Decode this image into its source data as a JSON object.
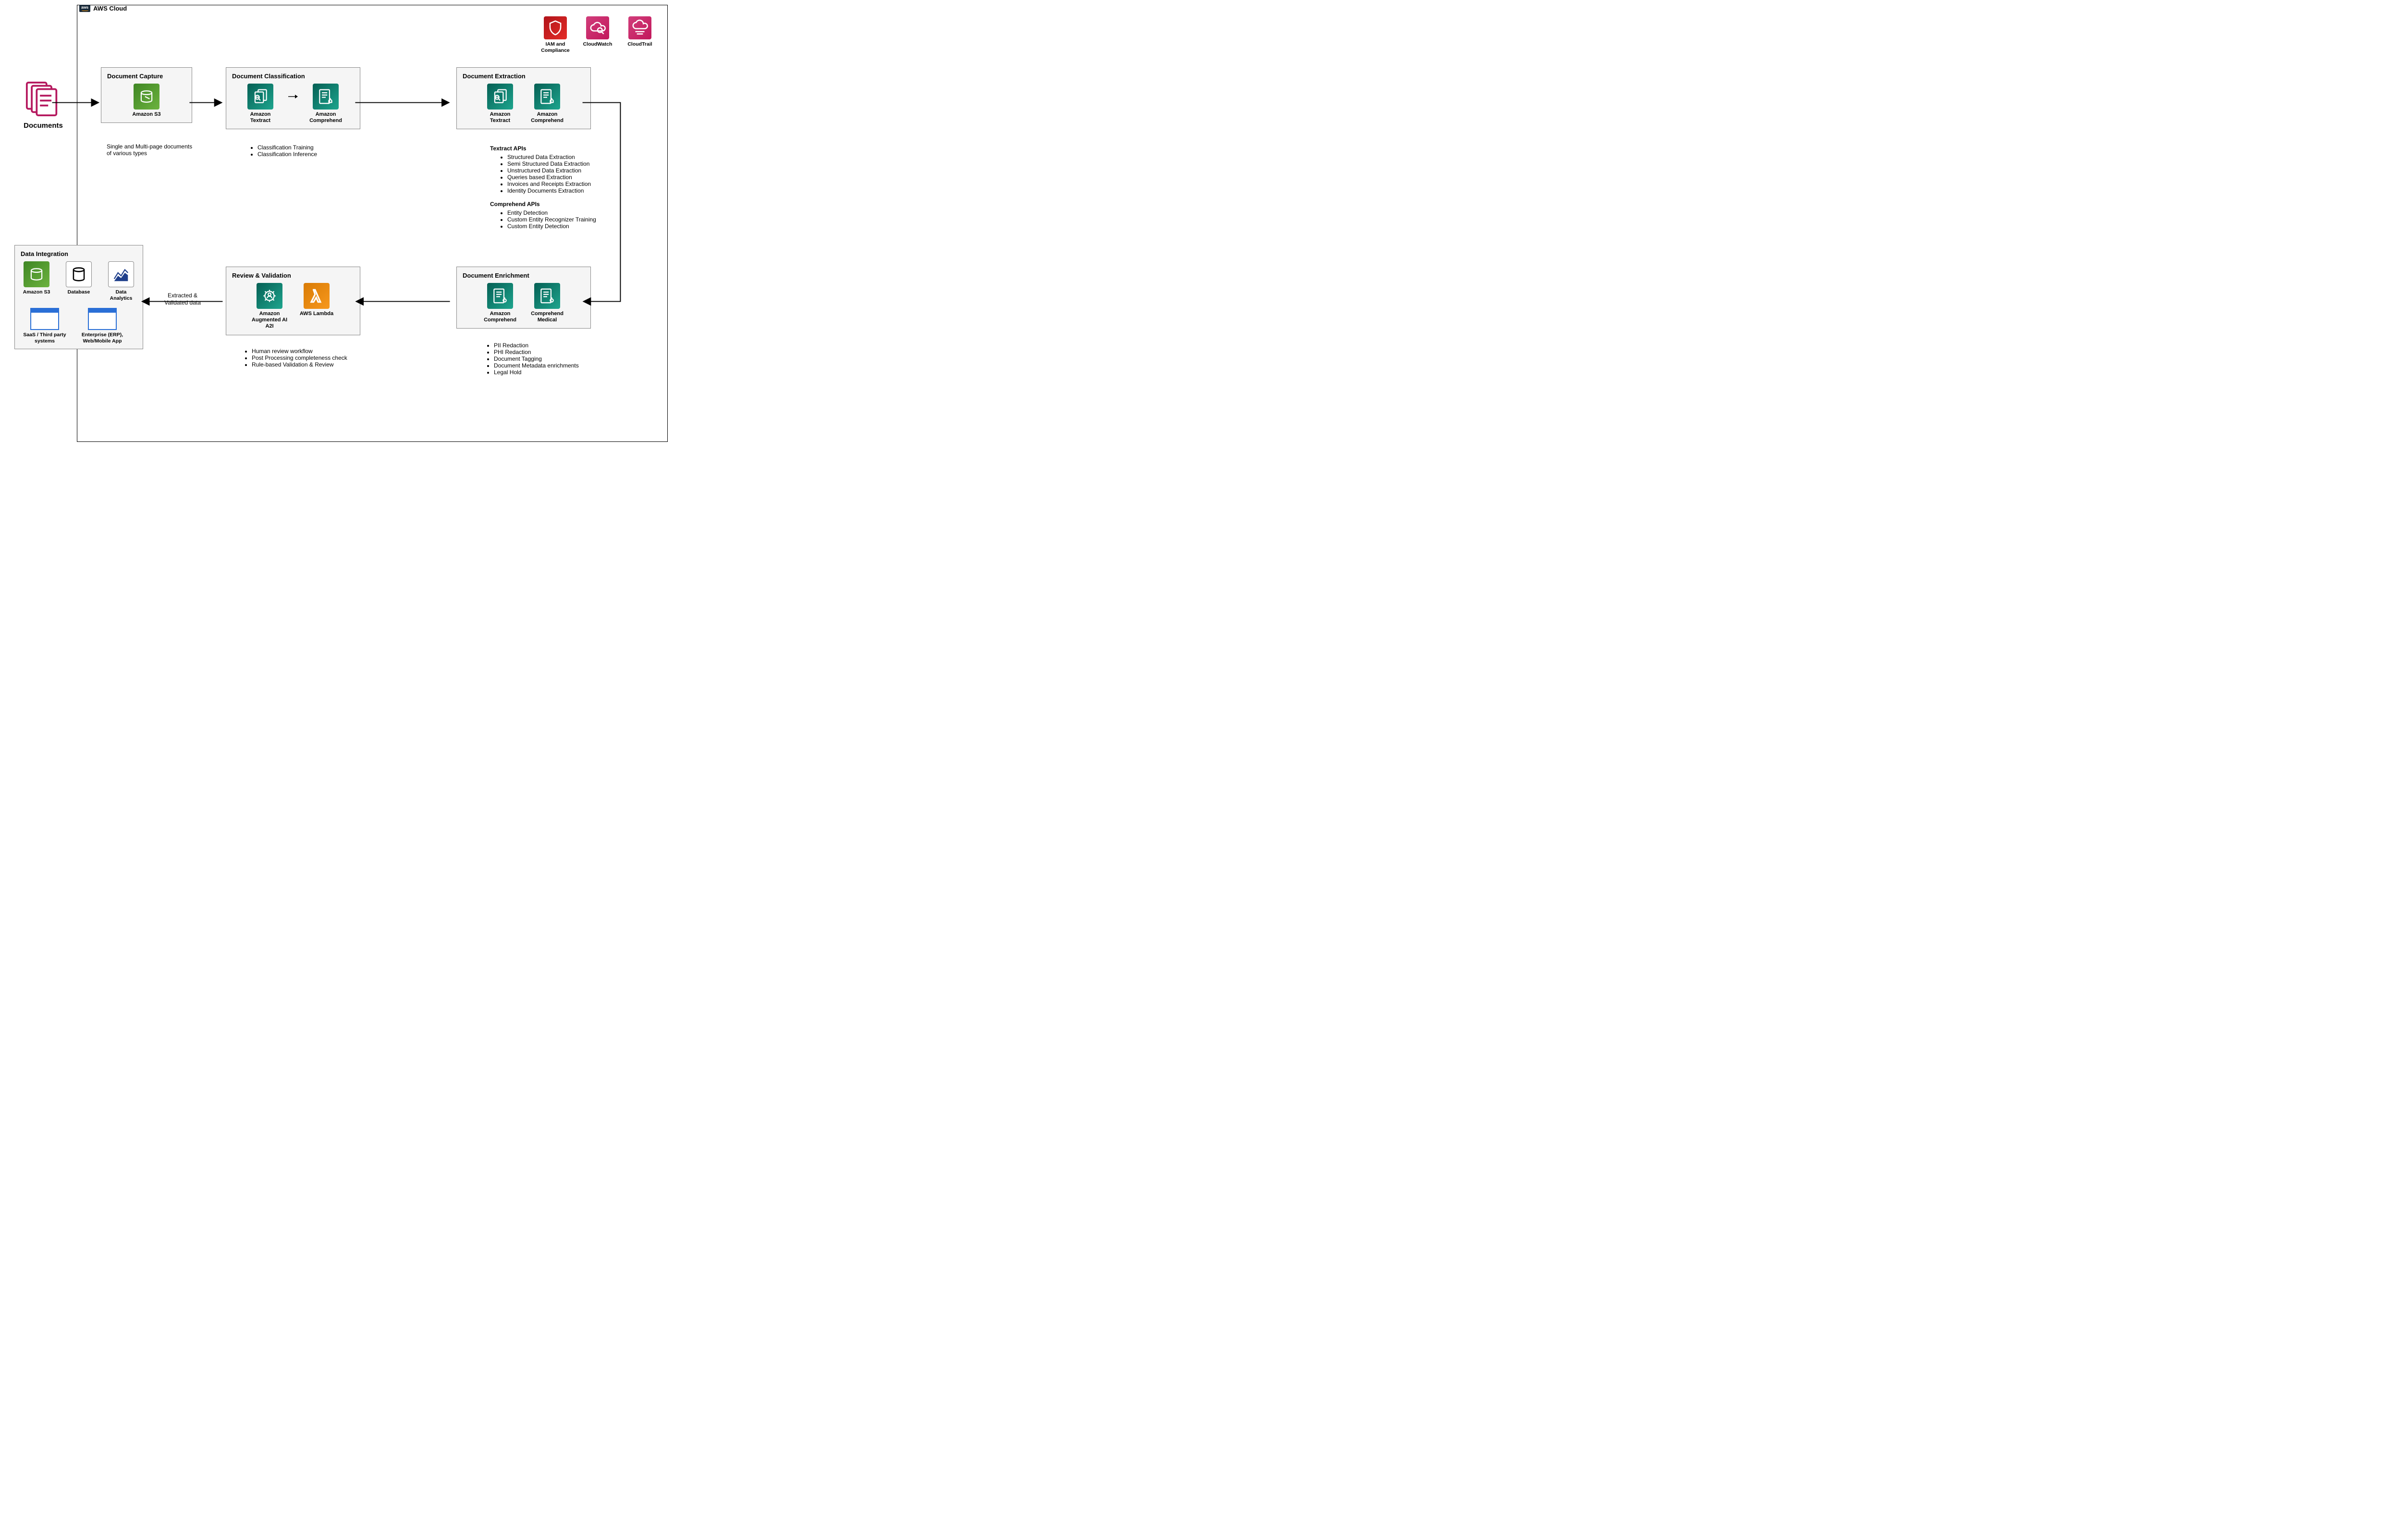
{
  "cloud_label": "AWS Cloud",
  "top_services": [
    {
      "name": "iam-compliance",
      "label": "IAM and Compliance"
    },
    {
      "name": "cloudwatch",
      "label": "CloudWatch"
    },
    {
      "name": "cloudtrail",
      "label": "CloudTrail"
    }
  ],
  "documents": {
    "label": "Documents"
  },
  "capture": {
    "title": "Document Capture",
    "service": "Amazon S3",
    "note": "Single and Multi-page documents of various types"
  },
  "classify": {
    "title": "Document Classification",
    "services": [
      "Amazon Textract",
      "Amazon Comprehend"
    ],
    "bullets": [
      "Classification Training",
      "Classification Inference"
    ]
  },
  "extract": {
    "title": "Document Extraction",
    "services": [
      "Amazon Textract",
      "Amazon Comprehend"
    ],
    "textract_title": "Textract  APIs",
    "textract_bullets": [
      "Structured Data Extraction",
      "Semi Structured Data Extraction",
      "Unstructured Data Extraction",
      "Queries based Extraction",
      "Invoices and Receipts Extraction",
      "Identity Documents Extraction"
    ],
    "comprehend_title": "Comprehend APIs",
    "comprehend_bullets": [
      "Entity Detection",
      "Custom Entity Recognizer Training",
      "Custom Entity Detection"
    ]
  },
  "enrich": {
    "title": "Document Enrichment",
    "services": [
      "Amazon Comprehend",
      "Comprehend Medical"
    ],
    "bullets": [
      "PII Redaction",
      "PHI Redaction",
      "Document Tagging",
      "Document Metadata enrichments",
      "Legal Hold"
    ]
  },
  "review": {
    "title": "Review & Validation",
    "services": [
      "Amazon Augmented AI A2I",
      "AWS Lambda"
    ],
    "bullets": [
      "Human review workflow",
      "Post Processing completeness check",
      "Rule-based Validation & Review"
    ]
  },
  "integrate": {
    "title": "Data Integration",
    "items": [
      {
        "label": "Amazon S3"
      },
      {
        "label": "Database"
      },
      {
        "label": "Data Analytics"
      },
      {
        "label": "SaaS / Third party systems"
      },
      {
        "label": "Enterprise (ERP), Web/Mobile App"
      }
    ],
    "arrow_label": "Extracted & Validated data"
  }
}
